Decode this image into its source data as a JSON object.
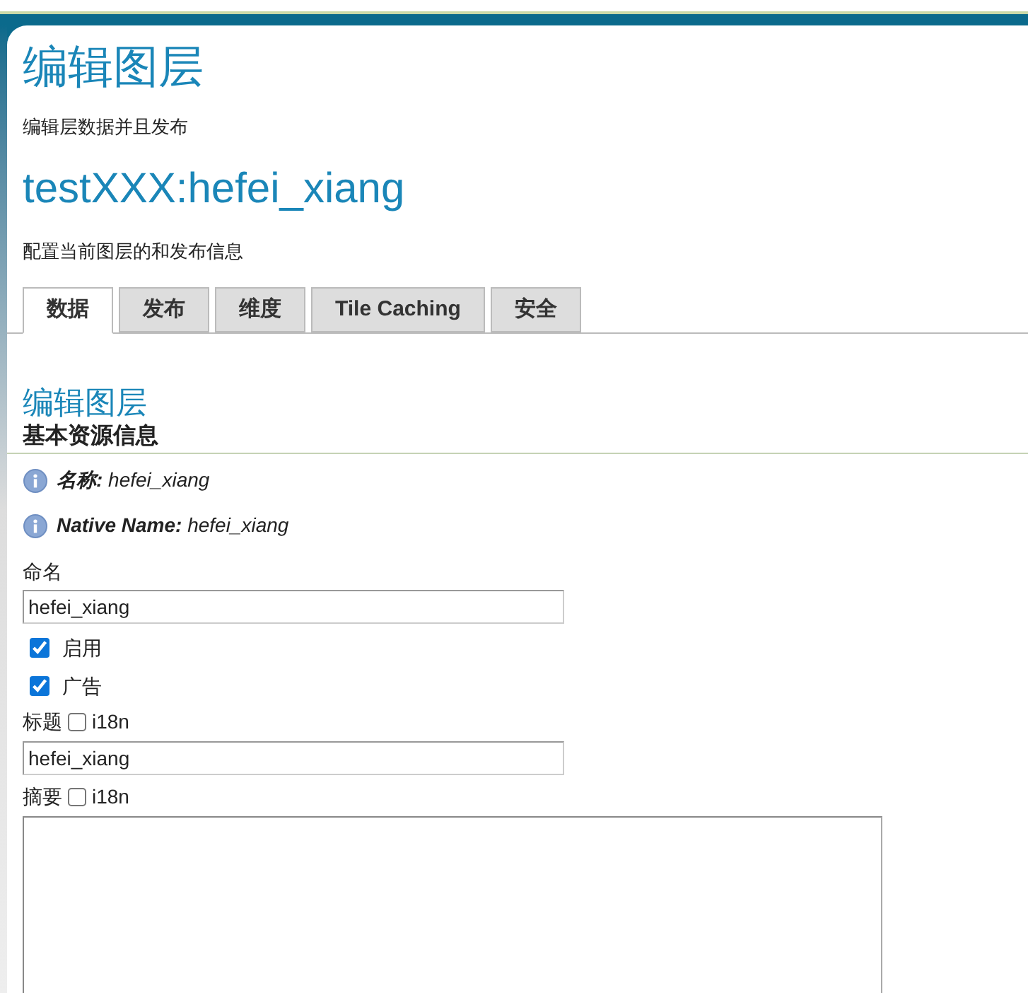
{
  "title": "编辑图层",
  "subtitle": "编辑层数据并且发布",
  "layer_title": "testXXX:hefei_xiang",
  "layer_description": "配置当前图层的和发布信息",
  "tabs": [
    {
      "label": "数据",
      "selected": true
    },
    {
      "label": "发布",
      "selected": false
    },
    {
      "label": "维度",
      "selected": false
    },
    {
      "label": "Tile Caching",
      "selected": false
    },
    {
      "label": "安全",
      "selected": false
    }
  ],
  "section_title": "编辑图层",
  "section_subtitle": "基本资源信息",
  "info": [
    {
      "label": "名称:",
      "value": "hefei_xiang"
    },
    {
      "label": "Native Name:",
      "value": "hefei_xiang"
    }
  ],
  "form": [
    {
      "kind": "text",
      "label": "命名",
      "value": "hefei_xiang"
    },
    {
      "kind": "checkbox",
      "label": "启用",
      "checked": true
    },
    {
      "kind": "checkbox",
      "label": "广告",
      "checked": true
    },
    {
      "kind": "i18n",
      "label": "标题",
      "option": "i18n",
      "checked": false
    },
    {
      "kind": "text",
      "value": "hefei_xiang"
    },
    {
      "kind": "i18n",
      "label": "摘要",
      "option": "i18n",
      "checked": false
    },
    {
      "kind": "textarea"
    }
  ]
}
